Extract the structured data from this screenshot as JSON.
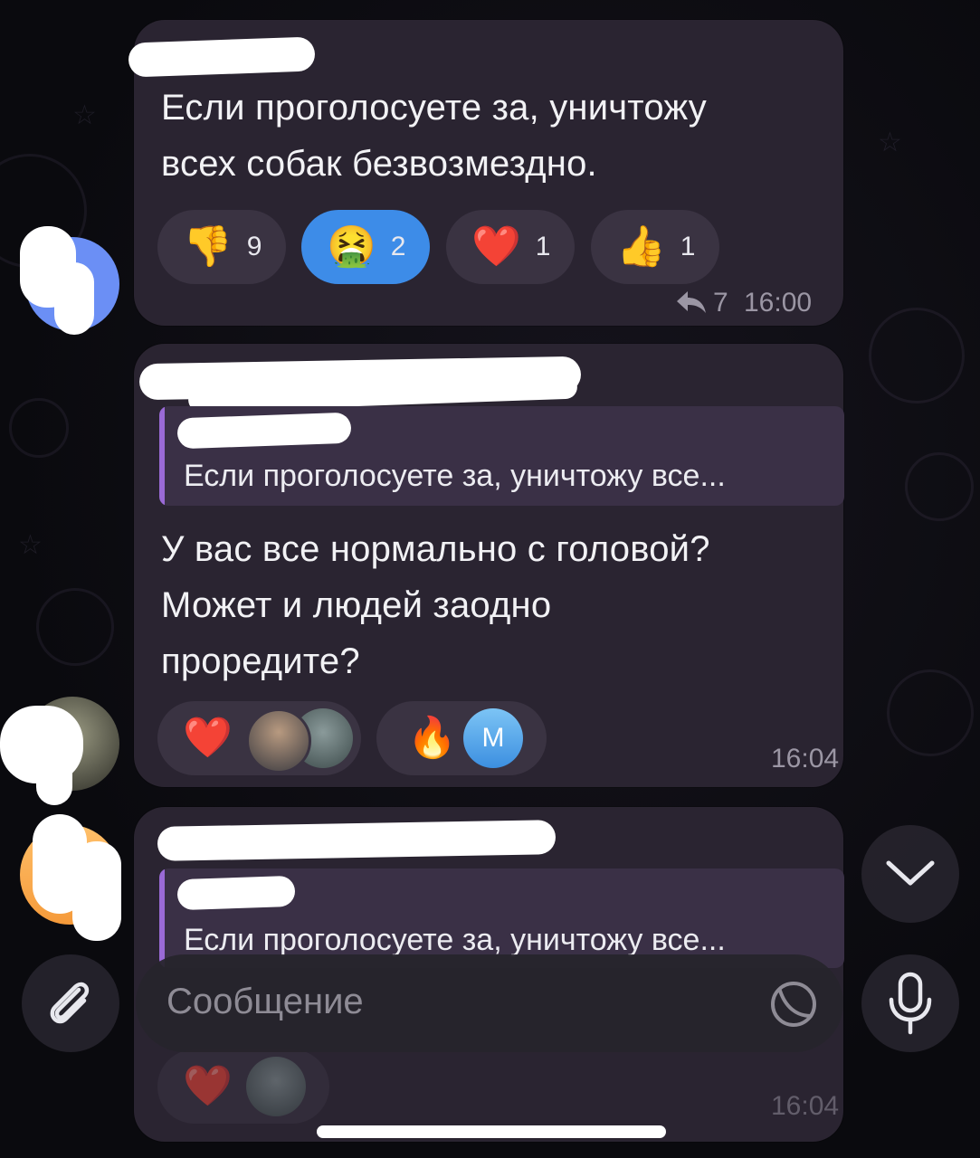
{
  "messages": [
    {
      "text_lines": [
        "Если проголосуете за, уничтожу",
        "всех собак безвозмездно."
      ],
      "reactions": [
        {
          "emoji": "👎",
          "count": "9",
          "active": false
        },
        {
          "emoji": "🤮",
          "count": "2",
          "active": true
        },
        {
          "emoji": "❤️",
          "count": "1",
          "active": false
        },
        {
          "emoji": "👍",
          "count": "1",
          "active": false
        }
      ],
      "reply_count": "7",
      "time": "16:00"
    },
    {
      "quote_text": "Если проголосуете за, уничтожу все...",
      "text_lines": [
        "У вас все нормально с головой?",
        "Может и людей заодно",
        "проредите?"
      ],
      "reactions": [
        {
          "emoji": "❤️"
        },
        {
          "emoji": "🔥",
          "avatar_letter": "М"
        }
      ],
      "time": "16:04"
    },
    {
      "quote_text": "Если проголосуете за, уничтожу все...",
      "reactions": [
        {
          "emoji": "❤️"
        }
      ],
      "time": "16:04"
    }
  ],
  "composer": {
    "placeholder": "Сообщение"
  },
  "icons": {
    "reply": "reply-arrow-icon",
    "attach": "paperclip-icon",
    "sticker": "sticker-icon",
    "mic": "microphone-icon",
    "scroll_down": "chevron-down-icon"
  },
  "colors": {
    "bubble": "#2a2431",
    "accent": "#3d8ce8",
    "quote_bar": "#9a6ad6"
  }
}
